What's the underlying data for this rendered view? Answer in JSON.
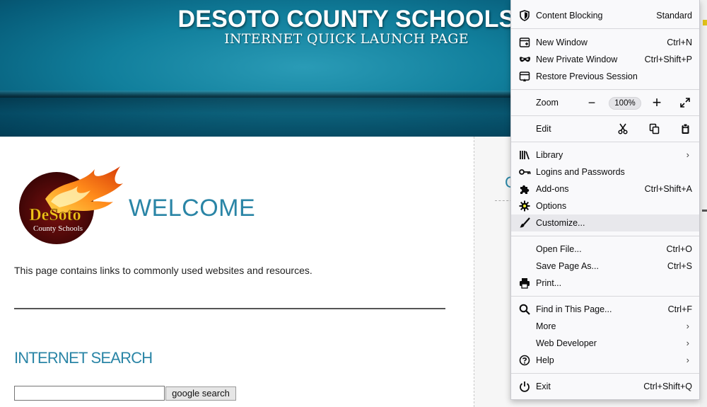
{
  "header": {
    "title": "DESOTO COUNTY SCHOOLS",
    "subtitle": "INTERNET QUICK LAUNCH PAGE"
  },
  "logo": {
    "line1": "DeSoto",
    "line2": "County Schools"
  },
  "main": {
    "welcome": "WELCOME",
    "intro": "This page contains links to commonly used websites and resources.",
    "search_heading": "INTERNET SEARCH",
    "search_value": "",
    "search_button": "google search"
  },
  "right_col": {
    "heading_fragment": "C"
  },
  "menu": {
    "content_blocking": {
      "label": "Content Blocking",
      "value": "Standard"
    },
    "new_window": {
      "label": "New Window",
      "shortcut": "Ctrl+N"
    },
    "new_private_window": {
      "label": "New Private Window",
      "shortcut": "Ctrl+Shift+P"
    },
    "restore_session": {
      "label": "Restore Previous Session"
    },
    "zoom": {
      "label": "Zoom",
      "minus": "−",
      "value": "100%",
      "plus": "+"
    },
    "edit": {
      "label": "Edit"
    },
    "library": {
      "label": "Library"
    },
    "logins": {
      "label": "Logins and Passwords"
    },
    "addons": {
      "label": "Add-ons",
      "shortcut": "Ctrl+Shift+A"
    },
    "options": {
      "label": "Options"
    },
    "customize": {
      "label": "Customize..."
    },
    "open_file": {
      "label": "Open File...",
      "shortcut": "Ctrl+O"
    },
    "save_page": {
      "label": "Save Page As...",
      "shortcut": "Ctrl+S"
    },
    "print": {
      "label": "Print..."
    },
    "find": {
      "label": "Find in This Page...",
      "shortcut": "Ctrl+F"
    },
    "more": {
      "label": "More"
    },
    "web_developer": {
      "label": "Web Developer"
    },
    "help": {
      "label": "Help"
    },
    "exit": {
      "label": "Exit",
      "shortcut": "Ctrl+Shift+Q"
    },
    "submenu_arrow": "›"
  },
  "colors": {
    "banner": "#075d7b",
    "heading_blue": "#2a85a6",
    "options_highlight": "#ffff33"
  }
}
